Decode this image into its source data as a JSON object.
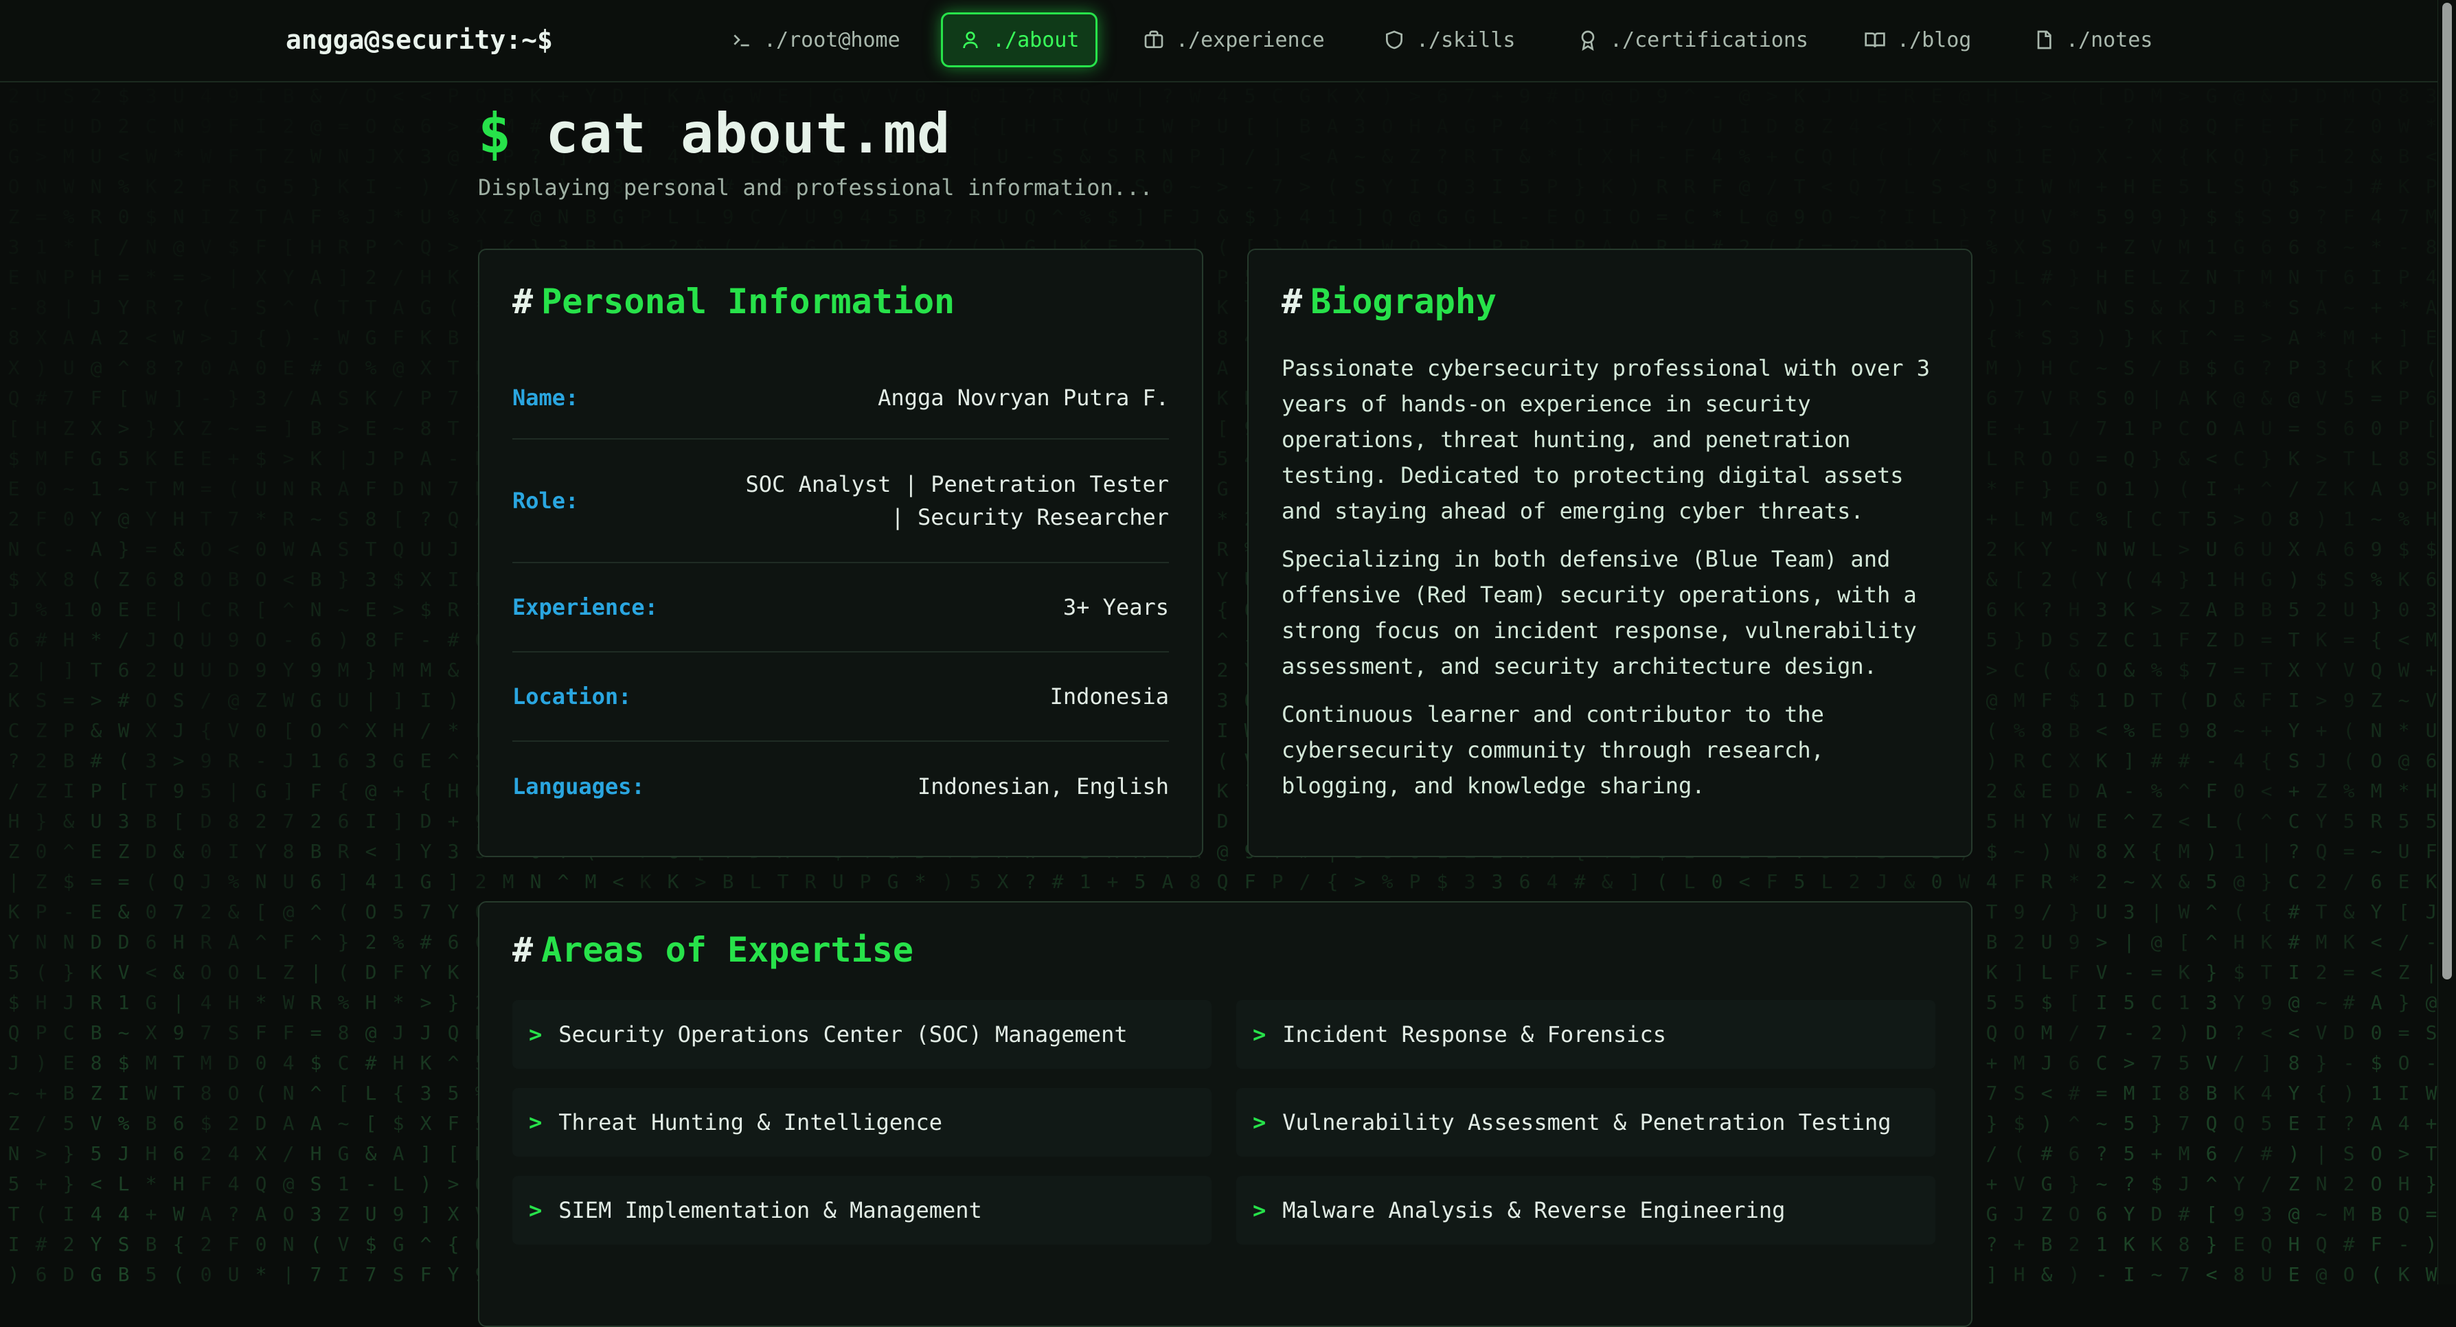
{
  "nav": {
    "brand": "angga@security:~$",
    "items": [
      {
        "label": "./root@home",
        "icon": "terminal-icon"
      },
      {
        "label": "./about",
        "icon": "user-icon",
        "active": true
      },
      {
        "label": "./experience",
        "icon": "briefcase-icon"
      },
      {
        "label": "./skills",
        "icon": "shield-icon"
      },
      {
        "label": "./certifications",
        "icon": "award-icon"
      },
      {
        "label": "./blog",
        "icon": "book-icon"
      },
      {
        "label": "./notes",
        "icon": "file-icon"
      }
    ]
  },
  "header": {
    "prompt": "$",
    "title": "cat about.md",
    "subtitle": "Displaying personal and professional information..."
  },
  "personal": {
    "hash": "#",
    "heading": "Personal Information",
    "rows": [
      {
        "label": "Name:",
        "value": "Angga Novryan Putra F."
      },
      {
        "label": "Role:",
        "value_lines": [
          "SOC Analyst | Penetration Tester",
          "| Security Researcher"
        ]
      },
      {
        "label": "Experience:",
        "value": "3+ Years"
      },
      {
        "label": "Location:",
        "value": "Indonesia"
      },
      {
        "label": "Languages:",
        "value": "Indonesian, English"
      }
    ]
  },
  "biography": {
    "hash": "#",
    "heading": "Biography",
    "paragraphs": [
      [
        "Passionate cybersecurity professional with over 3",
        "years of hands-on experience in security",
        "operations, threat hunting, and penetration",
        "testing. Dedicated to protecting digital assets",
        "and staying ahead of emerging cyber threats."
      ],
      [
        "Specializing in both defensive (Blue Team) and",
        "offensive (Red Team) security operations, with a",
        "strong focus on incident response, vulnerability",
        "assessment, and security architecture design."
      ],
      [
        "Continuous learner and contributor to the",
        "cybersecurity community through research,",
        "blogging, and knowledge sharing."
      ]
    ]
  },
  "expertise": {
    "hash": "#",
    "heading": "Areas of Expertise",
    "bullet": ">",
    "items": [
      "Security Operations Center (SOC) Management",
      "Incident Response & Forensics",
      "Threat Hunting & Intelligence",
      "Vulnerability Assessment & Penetration Testing",
      "SIEM Implementation & Management",
      "Malware Analysis & Reverse Engineering"
    ]
  },
  "colors": {
    "accent": "#27e24a",
    "label": "#2aa6e0",
    "background": "#0a0d0b"
  }
}
